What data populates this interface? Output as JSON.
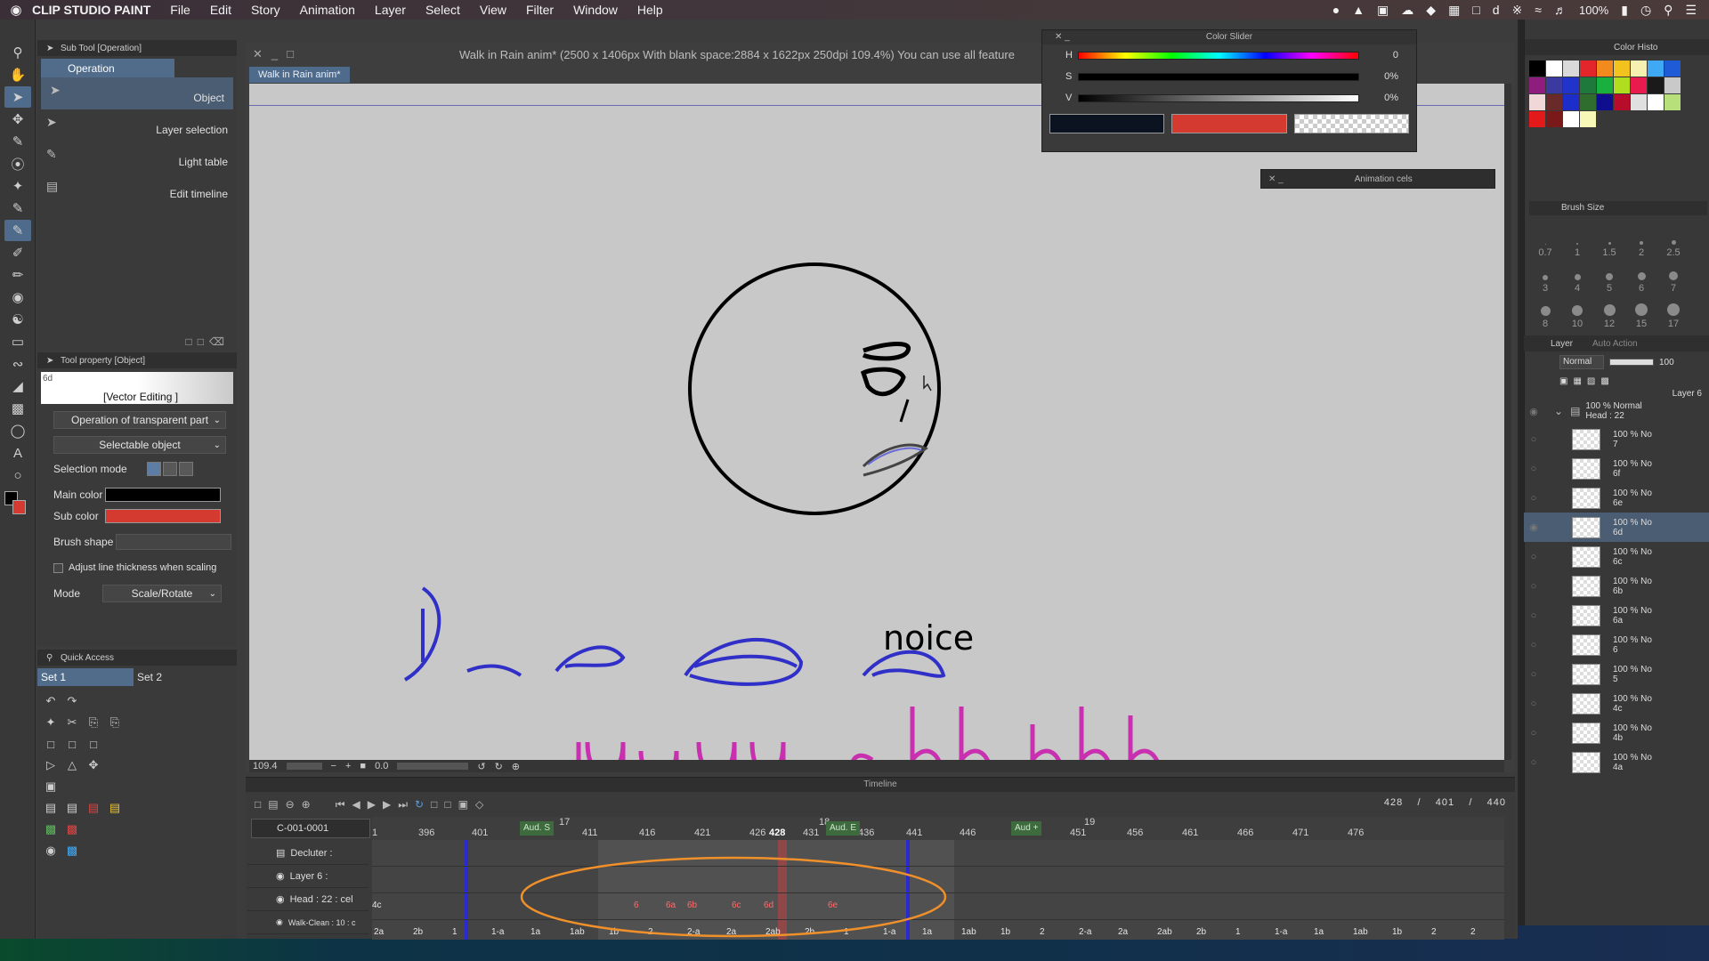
{
  "menubar": {
    "apple": "",
    "app_name": "CLIP STUDIO PAINT",
    "items": [
      "File",
      "Edit",
      "Story",
      "Animation",
      "Layer",
      "Select",
      "View",
      "Filter",
      "Window",
      "Help"
    ],
    "battery": "100%",
    "icons": [
      "creative-cloud-icon",
      "vlc-icon",
      "calendar-icon",
      "wifi-icon",
      "volume-icon",
      "clock-icon",
      "search-icon",
      "control-center-icon"
    ]
  },
  "subtool": {
    "title": "Sub Tool [Operation]",
    "tab": "Operation",
    "items": [
      "Object",
      "Layer selection",
      "Light table",
      "Edit timeline"
    ]
  },
  "toolprop": {
    "title": "Tool property [Object]",
    "preview_label": "[Vector Editing ]",
    "preview_badge": "6d",
    "transparent_dropdown": "Operation of transparent part",
    "selectable_dropdown": "Selectable object",
    "selection_mode_label": "Selection mode",
    "main_color_label": "Main color",
    "sub_color_label": "Sub color",
    "brush_shape_label": "Brush shape",
    "adjust_label": "Adjust line thickness when scaling",
    "mode_label": "Mode",
    "mode_value": "Scale/Rotate",
    "main_color": "#000000",
    "sub_color": "#d43a2f"
  },
  "quick": {
    "title": "Quick Access",
    "tabs": [
      "Set 1",
      "Set 2"
    ]
  },
  "canvaswin": {
    "title": "Walk in Rain anim* (2500 x 1406px With blank space:2884 x 1622px 250dpi 109.4%)  You can use all feature",
    "tab": "Walk in Rain anim*",
    "zoom": "109.4",
    "rotation": "0.0",
    "canvas_texts": [
      "noice"
    ]
  },
  "colorslider": {
    "title": "Color Slider",
    "h": "0",
    "s": "0%",
    "v": "0%",
    "labels": [
      "H",
      "S",
      "V"
    ],
    "colors": [
      "#0c1320",
      "#d43a2f"
    ]
  },
  "animcels": {
    "title": "Animation cels"
  },
  "colorhist": {
    "title": "Color Histo",
    "swatches": [
      "#000000",
      "#ffffff",
      "#d9d9d9",
      "#e3262b",
      "#f28a1e",
      "#f2c21e",
      "#f7f0b0",
      "#3fa9f5",
      "#1f5bd6",
      "#8e1d7d",
      "#3a3aa0",
      "#2233cc",
      "#1d7a3c",
      "#1ab03d",
      "#b0dd1e",
      "#e81a4e",
      "#1a1a1a",
      "#c9c9c9",
      "#f0d8d8",
      "#6a2a2a",
      "#1d2dc9",
      "#2e6d2e",
      "#0e0e8e",
      "#b80d2a",
      "#e0e0e0",
      "#ffffff",
      "#b8e07a",
      "#e41919",
      "#7a1919",
      "#ffffff",
      "#f7f7b8"
    ]
  },
  "brushsize": {
    "title": "Brush Size",
    "sizes": [
      "0.7",
      "1",
      "1.5",
      "2",
      "2.5",
      "3",
      "4",
      "5",
      "6",
      "7",
      "8",
      "10",
      "12",
      "15",
      "17"
    ]
  },
  "layer": {
    "title": "Layer",
    "title2": "Auto Action",
    "mode": "Normal",
    "opacity": "100",
    "top_layer": "Layer 6",
    "folder": {
      "line1": "100 % Normal",
      "line2": "Head : 22"
    },
    "rows": [
      {
        "a": "100 % No",
        "b": "7"
      },
      {
        "a": "100 % No",
        "b": "6f"
      },
      {
        "a": "100 % No",
        "b": "6e"
      },
      {
        "a": "100 % No",
        "b": "6d"
      },
      {
        "a": "100 % No",
        "b": "6c"
      },
      {
        "a": "100 % No",
        "b": "6b"
      },
      {
        "a": "100 % No",
        "b": "6a"
      },
      {
        "a": "100 % No",
        "b": "6"
      },
      {
        "a": "100 % No",
        "b": "5"
      },
      {
        "a": "100 % No",
        "b": "4c"
      },
      {
        "a": "100 % No",
        "b": "4b"
      },
      {
        "a": "100 % No",
        "b": "4a"
      }
    ]
  },
  "timeline": {
    "title": "Timeline",
    "current": "428",
    "start": "401",
    "end": "440",
    "slash": "/",
    "cut": "C-001-0001",
    "tracks": [
      "Decluter :",
      "Layer 6 :",
      "Head : 22 : cel",
      "Walk-Clean : 10 : c"
    ],
    "ruler": [
      "1",
      "396",
      "401",
      "17",
      "411",
      "416",
      "421",
      "426",
      "428",
      "431",
      "18",
      "436",
      "441",
      "446",
      "19",
      "451",
      "456",
      "461",
      "466",
      "471",
      "476"
    ],
    "aud": [
      "Aud. S",
      "Aud. E",
      "Aud +"
    ],
    "head_cels": [
      "4c",
      "6",
      "6a",
      "6b",
      "6c",
      "6d",
      "6e"
    ],
    "walk_cels": [
      "2a",
      "2b",
      "1",
      "1-a",
      "1a",
      "1ab",
      "1b",
      "2",
      "2-a",
      "2a",
      "2ab",
      "2b",
      "1",
      "1-a",
      "1a",
      "1ab",
      "1b",
      "2",
      "2-a",
      "2a",
      "2ab",
      "2b",
      "1",
      "1-a",
      "1a",
      "1ab",
      "1b",
      "2",
      "2"
    ]
  }
}
